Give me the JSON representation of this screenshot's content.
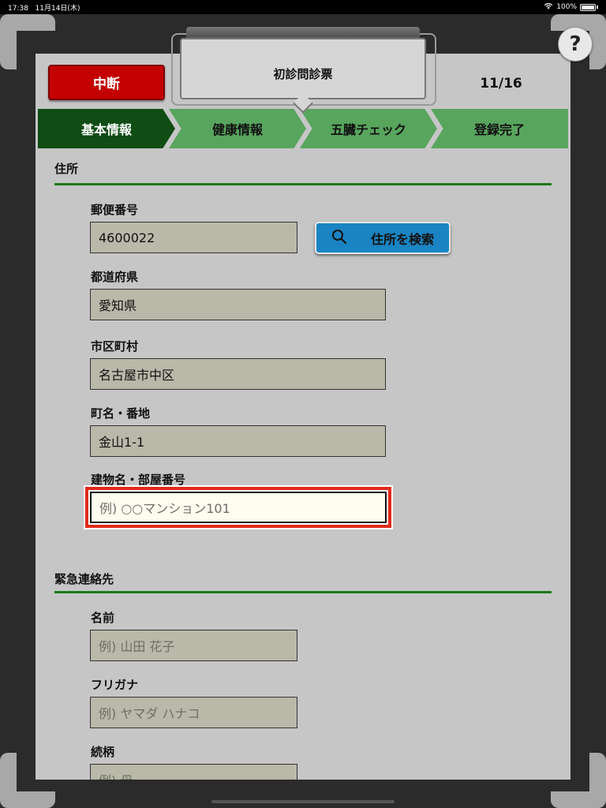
{
  "status_bar": {
    "time": "17:38",
    "date": "11月14日(木)",
    "battery": "100%"
  },
  "header": {
    "title": "初診問診票",
    "stop_label": "中断",
    "page_count": "11/16",
    "help_label": "?"
  },
  "steps": [
    {
      "label": "基本情報",
      "active": true
    },
    {
      "label": "健康情報",
      "active": false
    },
    {
      "label": "五臓チェック",
      "active": false
    },
    {
      "label": "登録完了",
      "active": false
    }
  ],
  "address": {
    "section_title": "住所",
    "postal_label": "郵便番号",
    "postal_value": "4600022",
    "search_label": "住所を検索",
    "prefecture_label": "都道府県",
    "prefecture_value": "愛知県",
    "city_label": "市区町村",
    "city_value": "名古屋市中区",
    "street_label": "町名・番地",
    "street_value": "金山1-1",
    "building_label": "建物名・部屋番号",
    "building_placeholder": "例) ○○マンション101"
  },
  "emergency": {
    "section_title": "緊急連絡先",
    "name_label": "名前",
    "name_placeholder": "例) 山田 花子",
    "kana_label": "フリガナ",
    "kana_placeholder": "例) ヤマダ ハナコ",
    "relation_label": "続柄",
    "relation_placeholder": "例) 母"
  },
  "colors": {
    "active_step": "#0f4d14",
    "step": "#58a55e",
    "stop_button": "#c40000",
    "search_button": "#1a84c2",
    "focus_outline": "#e12a1a"
  }
}
